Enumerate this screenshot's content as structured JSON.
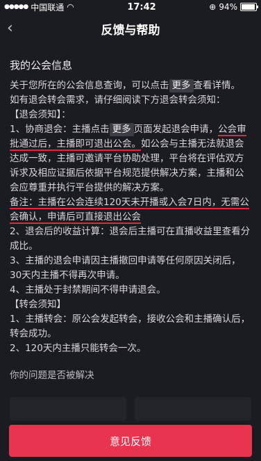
{
  "status_bar": {
    "carrier": "中国联通",
    "time": "17:42",
    "battery_text": "94%",
    "battery_level": 0.94
  },
  "nav": {
    "back_icon": "chevron-left-icon",
    "title": "反馈与帮助"
  },
  "section": {
    "title": "我的公会信息",
    "p1_a": "关于您所在的公会信息查询，可以点击",
    "more_label": "更多",
    "p1_b": "查看详情。",
    "p2": "如有退会转会需求，请仔细阅读下方退会转会须知：",
    "exit_heading": "【退会须知】：",
    "item1_a": "1、协商退会：主播点击",
    "item1_more": "更多",
    "item1_b": "页面发起退会申请，",
    "item1_hl1": "公会审批通过后，主播即可退出公会。",
    "item1_c": "如公会与主播无法就退会达成一致，主播可邀请平台协助处理，平台将在评估双方诉求及相应证据后依据平台规范提供解决方案，主播和公会应尊重并执行平台提供的解决方案。",
    "note_hl": "备注：主播在公会连续120天未开播或入会7日内，无需公会确认，申请后可直接退出公会",
    "item2": "2、退会后的收益计算：退会后主播可在直播收益里查看分成比。",
    "item3": "3、主播的退会申请因主播撤回申请等任何原因关闭后，30天内主播不得再次申请。",
    "item4": "4、主播处于封禁期间不得申请退会。",
    "transfer_heading": "【转会须知】",
    "t1": "1、主播转会：原公会发起转会，接收公会和主播确认后，转会成功。",
    "t2": "2、120天内主播只能转会一次。"
  },
  "question": {
    "text": "你的问题是否被解决",
    "resolved_label": "",
    "unresolved_label": ""
  },
  "footer": {
    "feedback_label": "意见反馈"
  },
  "colors": {
    "accent": "#e9344f",
    "underline": "#e3283b",
    "background": "#1b1b22"
  }
}
